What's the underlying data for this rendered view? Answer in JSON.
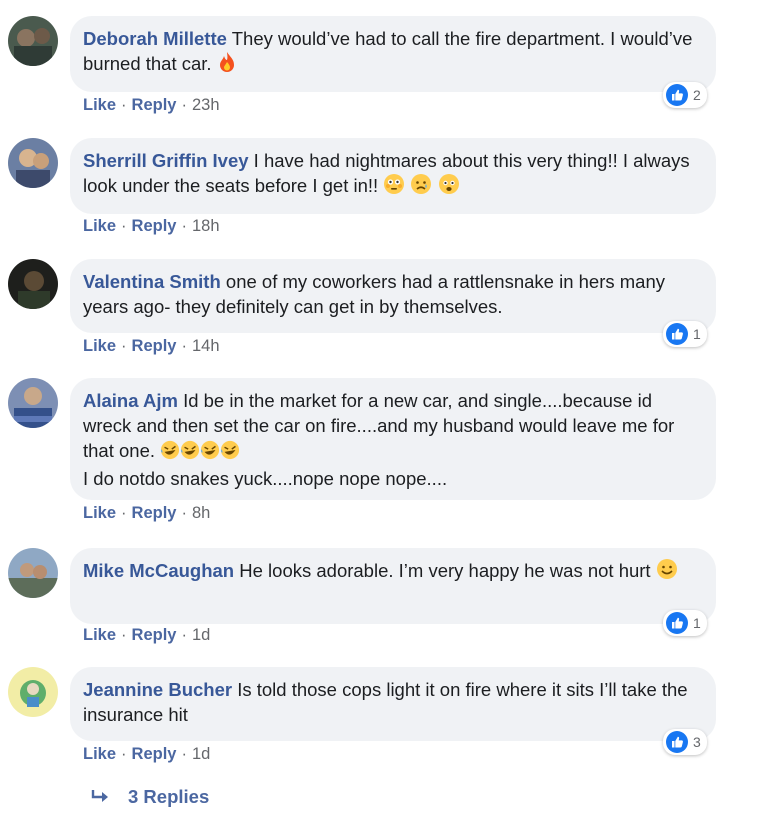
{
  "comments": [
    {
      "author": "Deborah Millette",
      "text": "They would’ve had to call the fire department. I would’ve burned that car.",
      "like": "Like",
      "reply": "Reply",
      "time": "23h",
      "reactions": "2"
    },
    {
      "author": "Sherrill Griffin Ivey",
      "text": "I have had nightmares about this very thing!! I always look under the seats before I get in!!",
      "like": "Like",
      "reply": "Reply",
      "time": "18h"
    },
    {
      "author": "Valentina Smith",
      "text": "one of my coworkers had a rattlensnake in hers many years ago- they definitely can get in by themselves.",
      "like": "Like",
      "reply": "Reply",
      "time": "14h",
      "reactions": "1"
    },
    {
      "author": "Alaina Ajm",
      "text": "Id be in the market for a new car, and single....because id wreck and then set the car on fire....and my husband would leave me for that one.",
      "text2": "I do notdo snakes yuck....nope nope nope....",
      "like": "Like",
      "reply": "Reply",
      "time": "8h"
    },
    {
      "author": "Mike McCaughan",
      "text": "He looks adorable. I’m very happy he was not hurt",
      "like": "Like",
      "reply": "Reply",
      "time": "1d",
      "reactions": "1"
    },
    {
      "author": "Jeannine Bucher",
      "text": "Is told those cops light it on fire where it sits I’ll take the insurance hit",
      "like": "Like",
      "reply": "Reply",
      "time": "1d",
      "reactions": "3"
    }
  ],
  "more_replies": "3 Replies",
  "colors": {
    "author": "#385898",
    "bubble": "#f0f2f5",
    "link": "#4b67a1",
    "like_badge": "#1877f2"
  }
}
